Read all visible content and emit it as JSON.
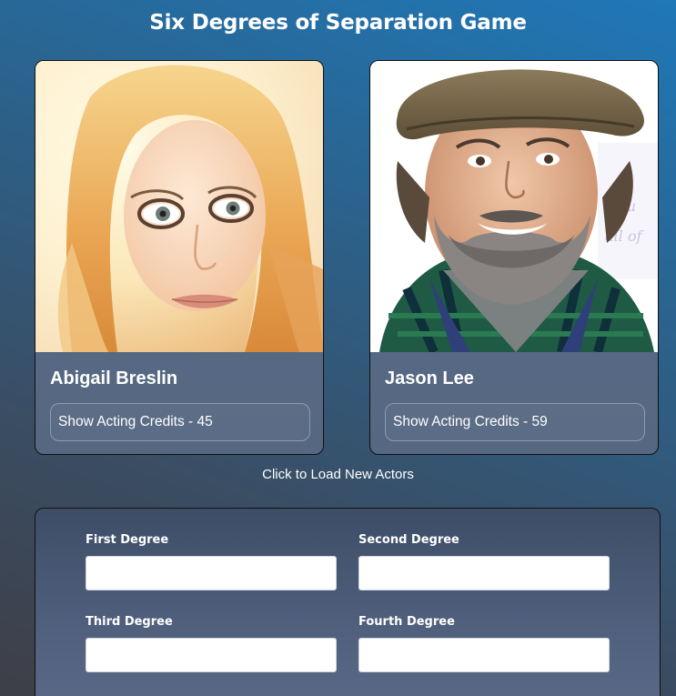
{
  "title": "Six Degrees of Separation Game",
  "actors": [
    {
      "name": "Abigail Breslin",
      "credits_label": "Show Acting Credits - 45",
      "credits_count": 45,
      "photo": "actor-portrait-blonde-woman"
    },
    {
      "name": "Jason Lee",
      "credits_label": "Show Acting Credits - 59",
      "credits_count": 59,
      "photo": "actor-portrait-bearded-man-flat-cap"
    }
  ],
  "load_new_label": "Click to Load New Actors",
  "degrees": [
    {
      "label": "First Degree",
      "value": "",
      "placeholder": ""
    },
    {
      "label": "Second Degree",
      "value": "",
      "placeholder": ""
    },
    {
      "label": "Third Degree",
      "value": "",
      "placeholder": ""
    },
    {
      "label": "Fourth Degree",
      "value": "",
      "placeholder": ""
    }
  ],
  "colors": {
    "background_top": "#1f78b8",
    "background_bottom": "#3e3f47",
    "card": "#5a6e89",
    "panel": "#4f5f7c",
    "text": "#ffffff"
  }
}
